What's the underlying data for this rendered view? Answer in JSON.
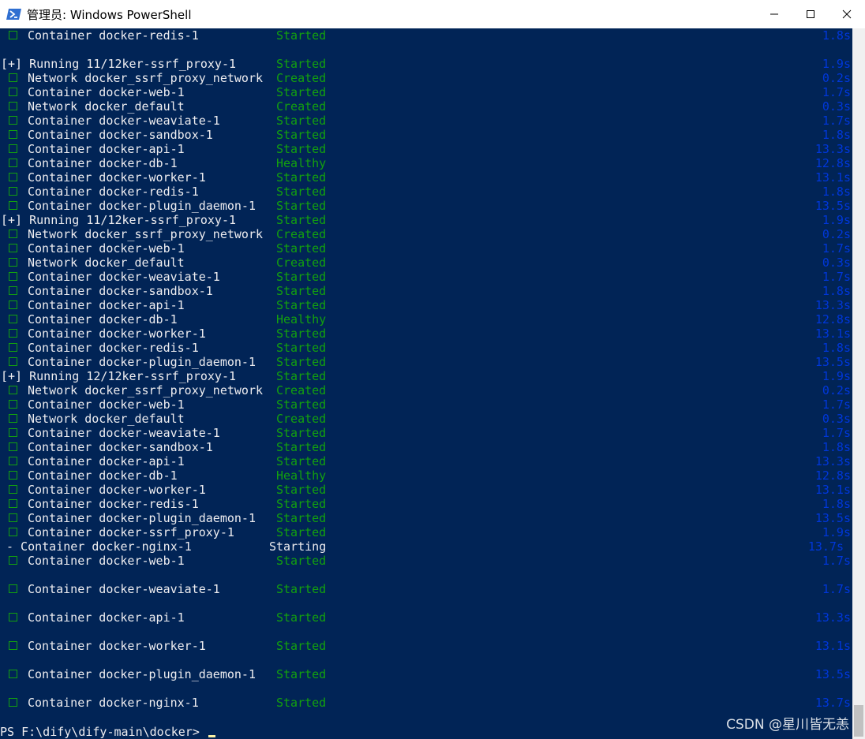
{
  "window": {
    "title": "管理员: Windows PowerShell",
    "icon": "powershell-icon",
    "controls": [
      "minimize-icon",
      "maximize-icon",
      "close-icon"
    ]
  },
  "colors": {
    "console_bg": "#012456",
    "text": "#eeedf0",
    "green": "#13a10e",
    "blue": "#0037da"
  },
  "lines": [
    {
      "name": "Container docker-redis-1",
      "status": "Started",
      "dur": "1.8s"
    },
    {
      "name": "",
      "status": "",
      "dur": ""
    },
    {
      "prefix": "running",
      "name": "[+] Running 11/12ker-ssrf_proxy-1",
      "status": "Started",
      "dur": "1.9s"
    },
    {
      "name": "Network docker_ssrf_proxy_network",
      "status": "Created",
      "dur": "0.2s"
    },
    {
      "name": "Container docker-web-1",
      "status": "Started",
      "dur": "1.7s"
    },
    {
      "name": "Network docker_default",
      "status": "Created",
      "dur": "0.3s"
    },
    {
      "name": "Container docker-weaviate-1",
      "status": "Started",
      "dur": "1.7s"
    },
    {
      "name": "Container docker-sandbox-1",
      "status": "Started",
      "dur": "1.8s"
    },
    {
      "name": "Container docker-api-1",
      "status": "Started",
      "dur": "13.3s"
    },
    {
      "name": "Container docker-db-1",
      "status": "Healthy",
      "dur": "12.8s"
    },
    {
      "name": "Container docker-worker-1",
      "status": "Started",
      "dur": "13.1s"
    },
    {
      "name": "Container docker-redis-1",
      "status": "Started",
      "dur": "1.8s"
    },
    {
      "name": "Container docker-plugin_daemon-1",
      "status": "Started",
      "dur": "13.5s"
    },
    {
      "prefix": "running",
      "name": "[+] Running 11/12ker-ssrf_proxy-1",
      "status": "Started",
      "dur": "1.9s"
    },
    {
      "name": "Network docker_ssrf_proxy_network",
      "status": "Created",
      "dur": "0.2s"
    },
    {
      "name": "Container docker-web-1",
      "status": "Started",
      "dur": "1.7s"
    },
    {
      "name": "Network docker_default",
      "status": "Created",
      "dur": "0.3s"
    },
    {
      "name": "Container docker-weaviate-1",
      "status": "Started",
      "dur": "1.7s"
    },
    {
      "name": "Container docker-sandbox-1",
      "status": "Started",
      "dur": "1.8s"
    },
    {
      "name": "Container docker-api-1",
      "status": "Started",
      "dur": "13.3s"
    },
    {
      "name": "Container docker-db-1",
      "status": "Healthy",
      "dur": "12.8s"
    },
    {
      "name": "Container docker-worker-1",
      "status": "Started",
      "dur": "13.1s"
    },
    {
      "name": "Container docker-redis-1",
      "status": "Started",
      "dur": "1.8s"
    },
    {
      "name": "Container docker-plugin_daemon-1",
      "status": "Started",
      "dur": "13.5s"
    },
    {
      "prefix": "running-dim",
      "name": "[+] Running 12/12ker-ssrf_proxy-1",
      "status": "Started",
      "dur": "1.9s"
    },
    {
      "name": "Network docker_ssrf_proxy_network",
      "status": "Created",
      "dur": "0.2s"
    },
    {
      "name": "Container docker-web-1",
      "status": "Started",
      "dur": "1.7s"
    },
    {
      "name": "Network docker_default",
      "status": "Created",
      "dur": "0.3s"
    },
    {
      "name": "Container docker-weaviate-1",
      "status": "Started",
      "dur": "1.7s"
    },
    {
      "name": "Container docker-sandbox-1",
      "status": "Started",
      "dur": "1.8s"
    },
    {
      "name": "Container docker-api-1",
      "status": "Started",
      "dur": "13.3s"
    },
    {
      "name": "Container docker-db-1",
      "status": "Healthy",
      "dur": "12.8s"
    },
    {
      "name": "Container docker-worker-1",
      "status": "Started",
      "dur": "13.1s"
    },
    {
      "name": "Container docker-redis-1",
      "status": "Started",
      "dur": "1.8s"
    },
    {
      "name": "Container docker-plugin_daemon-1",
      "status": "Started",
      "dur": "13.5s"
    },
    {
      "name": "Container docker-ssrf_proxy-1",
      "status": "Started",
      "dur": "1.9s"
    },
    {
      "prefix": "dash",
      "name": "- Container docker-nginx-1",
      "status": "Starting",
      "dur": "13.7s"
    },
    {
      "name": "Container docker-web-1",
      "status": "Started",
      "dur": "1.7s"
    },
    {
      "name": "",
      "status": "",
      "dur": ""
    },
    {
      "name": "Container docker-weaviate-1",
      "status": "Started",
      "dur": "1.7s"
    },
    {
      "name": "",
      "status": "",
      "dur": ""
    },
    {
      "name": "Container docker-api-1",
      "status": "Started",
      "dur": "13.3s"
    },
    {
      "name": "",
      "status": "",
      "dur": ""
    },
    {
      "name": "Container docker-worker-1",
      "status": "Started",
      "dur": "13.1s"
    },
    {
      "name": "",
      "status": "",
      "dur": ""
    },
    {
      "name": "Container docker-plugin_daemon-1",
      "status": "Started",
      "dur": "13.5s"
    },
    {
      "name": "",
      "status": "",
      "dur": ""
    },
    {
      "name": "Container docker-nginx-1",
      "status": "Started",
      "dur": "13.7s"
    }
  ],
  "prompt": "PS F:\\dify\\dify-main\\docker> ",
  "watermark": "CSDN @星川皆无恙"
}
